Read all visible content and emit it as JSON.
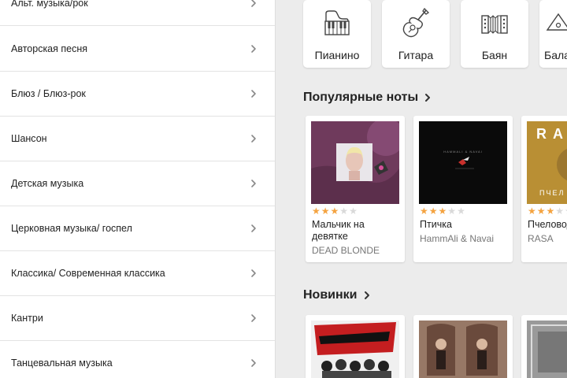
{
  "categories": [
    {
      "label": "Альт. музыка/рок"
    },
    {
      "label": "Авторская песня"
    },
    {
      "label": "Блюз / Блюз-рок"
    },
    {
      "label": "Шансон"
    },
    {
      "label": "Детская музыка"
    },
    {
      "label": "Церковная музыка/ госпел"
    },
    {
      "label": "Классика/ Современная классика"
    },
    {
      "label": "Кантри"
    },
    {
      "label": "Танцевальная музыка"
    }
  ],
  "instruments": [
    {
      "label": "Пианино",
      "icon": "piano-icon"
    },
    {
      "label": "Гитара",
      "icon": "guitar-icon"
    },
    {
      "label": "Баян",
      "icon": "accordion-icon"
    },
    {
      "label": "Балалайка",
      "icon": "balalaika-icon"
    }
  ],
  "popular": {
    "title": "Популярные ноты",
    "items": [
      {
        "title": "Мальчик на девятке",
        "artist": "DEAD BLONDE",
        "rating": 3,
        "max_rating": 5,
        "cover_color": "#8a4a6e"
      },
      {
        "title": "Птичка",
        "artist": "HammAli & Navai",
        "rating": 3,
        "max_rating": 5,
        "cover_color": "#0a0a0a",
        "cover_text": "HAMMALI & NAVAI"
      },
      {
        "title": "Пчеловод",
        "artist": "RASA",
        "rating": 3,
        "max_rating": 5,
        "cover_color": "#c29a3a",
        "cover_text_big": "RA",
        "cover_text_small": "ПЧЕЛ"
      }
    ]
  },
  "new": {
    "title": "Новинки",
    "items": [
      {
        "cover_color": "#c41e20"
      },
      {
        "cover_color": "#7a5a4a"
      },
      {
        "cover_color": "#9a9a9a"
      }
    ]
  },
  "colors": {
    "star": "#f4a340",
    "star_off": "#d9d9d9"
  }
}
